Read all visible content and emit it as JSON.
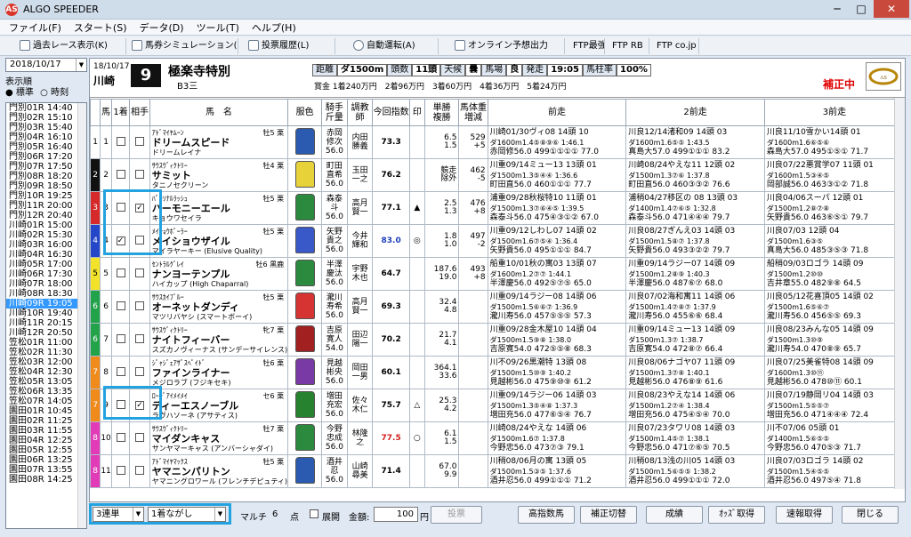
{
  "app": {
    "title": "ALGO SPEEDER",
    "icon_text": "AS"
  },
  "menu": [
    "ファイル(F)",
    "スタート(S)",
    "データ(D)",
    "ツール(T)",
    "ヘルプ(H)"
  ],
  "toolbar": [
    "過去レース表示(K)",
    "馬券シミュレーション(B)",
    "投票履歴(L)",
    "自動運転(A)",
    "オンライン予想出力",
    "FTP最強",
    "FTP RB",
    "FTP co.jp"
  ],
  "left": {
    "date": "2018/10/17",
    "display_order_label": "表示順",
    "radio_standard": "● 標準",
    "radio_time": "○ 時刻",
    "races": [
      "門別01R 14:40",
      "門別02R 15:10",
      "門別03R 15:40",
      "門別04R 16:10",
      "門別05R 16:40",
      "門別06R 17:20",
      "門別07R 17:50",
      "門別08R 18:20",
      "門別09R 18:50",
      "門別10R 19:25",
      "門別11R 20:00",
      "門別12R 20:40",
      "川崎01R 15:00",
      "川崎02R 15:30",
      "川崎03R 16:00",
      "川崎04R 16:30",
      "川崎05R 17:00",
      "川崎06R 17:30",
      "川崎07R 18:00",
      "川崎08R 18:30",
      "川崎09R 19:05",
      "川崎10R 19:40",
      "川崎11R 20:15",
      "川崎12R 20:50",
      "笠松01R 11:00",
      "笠松02R 11:30",
      "笠松03R 12:00",
      "笠松04R 12:30",
      "笠松05R 13:05",
      "笠松06R 13:35",
      "笠松07R 14:05",
      "園田01R 10:45",
      "園田02R 11:25",
      "園田03R 11:55",
      "園田04R 12:25",
      "園田05R 12:55",
      "園田06R 13:25",
      "園田07R 13:55",
      "園田08R 14:25"
    ],
    "selected_index": 20
  },
  "race": {
    "date": "18/10/17",
    "track": "川崎",
    "number": "9",
    "name": "極楽寺特別",
    "class": "B3三",
    "conditions": [
      [
        "距離",
        "ダ1500m"
      ],
      [
        "頭数",
        "11頭"
      ],
      [
        "天候",
        "曇"
      ],
      [
        "馬場",
        "良"
      ],
      [
        "発走",
        "19:05"
      ],
      [
        "馬柱率",
        "100%"
      ]
    ],
    "prize": "賞金 1着240万円　2着96万円　3着60万円　4着36万円　5着24万円",
    "status": "補正中"
  },
  "columns": [
    "馬",
    "1着",
    "相手",
    "馬　名",
    "服色",
    "騎手\n斤量",
    "調教\n師",
    "今回指数",
    "印",
    "単勝\n複勝",
    "馬体重\n増減",
    "前走",
    "2前走",
    "3前走"
  ],
  "horses": [
    {
      "waku": "1",
      "wcolor": "#ffffff",
      "wtext": "#000",
      "num": "1",
      "c1": "",
      "c2": "",
      "sire": "ｱﾄﾞﾏｲﾔﾑｰﾝ",
      "name": "ドリームスピード",
      "dam": "ドリームレイナ",
      "sex": "牡5 栗",
      "jockey": "赤岡\n修次\n56.0",
      "trainer": "内田\n勝義",
      "index": "73.3",
      "idxcolor": "#000",
      "mark": "",
      "odds": "6.5\n1.5",
      "weight": "529\n+5",
      "p1": [
        "川崎01/30ヴィ08 14頭 10",
        "ダ1600m1.4⑤⑧⑨⑥ 1:46.1",
        "赤岡修56.0 499①①①① 77.0"
      ],
      "p2": [
        "川良12/14渚和09 14頭 03",
        "ダ1600m1.6⑤⑤ 1:43.5",
        "真島大57.0 499①①① 83.2"
      ],
      "p3": [
        "川良11/10雪かい14頭 01",
        "ダ1600m1.6⑥⑤⑥",
        "森島大57.0 495①⑤① 71.7"
      ],
      "silk": "#2a5bb0"
    },
    {
      "waku": "2",
      "wcolor": "#111111",
      "wtext": "#fff",
      "num": "2",
      "c1": "",
      "c2": "",
      "sire": "ｻｳｽｳﾞｨｸﾄﾘｰ",
      "name": "サミット",
      "dam": "タニノセクリーン",
      "sex": "牡4 栗",
      "jockey": "町田\n直希\n56.0",
      "trainer": "玉田\n一之",
      "index": "76.2",
      "idxcolor": "#000",
      "mark": "",
      "odds": "競走\n除外",
      "weight": "462\n-5",
      "p1": [
        "川重09/14ミュー13 13頭 01",
        "ダ1500m1.3⑤④④ 1:36.6",
        "町田直56.0 460①①① 77.7"
      ],
      "p2": [
        "川崎08/24やえな11 12頭 02",
        "ダ1500m1.3⑦⑥ 1:37.8",
        "町田直56.0 460③③② 76.6"
      ],
      "p3": [
        "川良07/22悪賞学07 11頭 01",
        "ダ1600m1.5③④⑤",
        "岡部誠56.0 463③①② 71.8"
      ],
      "silk": "#e8d23a"
    },
    {
      "waku": "3",
      "wcolor": "#d62a2a",
      "wtext": "#fff",
      "num": "3",
      "c1": "",
      "c2": "✓",
      "sire": "ﾊﾟｰｿﾅﾙﾗｯｼｭ",
      "name": "ハーモニーエール",
      "dam": "キョウワセイラ",
      "sex": "牡5 栗",
      "jockey": "森泰\n斗\n56.0",
      "trainer": "高月\n賢一",
      "index": "77.1",
      "idxcolor": "#000",
      "mark": "▲",
      "odds": "2.5\n1.3",
      "weight": "476\n+8",
      "p1": [
        "浦重09/28秋桜特10 11頭 01",
        "ダ1500m1.3⑦⑥④⑤ 1:39.5",
        "森泰斗56.0 475④③①② 67.0"
      ],
      "p2": [
        "浦稍04/27移区の 08 13頭 03",
        "ダ1400m1.4⑦⑥⑤ 1:32.8",
        "森泰斗56.0 471④④④ 79.7"
      ],
      "p3": [
        "川良04/06スーパ 12頭 01",
        "ダ1500m1.2⑧⑦⑧",
        "矢野貴56.0 463⑥⑤① 79.7"
      ],
      "silk": "#2c8a3e"
    },
    {
      "waku": "4",
      "wcolor": "#2446c9",
      "wtext": "#fff",
      "num": "4",
      "c1": "✓",
      "c2": "",
      "sire": "ﾒｲｼｮｳﾎﾞｰﾗｰ",
      "name": "メイショウザイル",
      "dam": "マイラヤーキー (Elusive Quality)",
      "sex": "牡5 栗",
      "jockey": "矢野\n貴之\n56.0",
      "trainer": "今井\n輝和",
      "index": "83.0",
      "idxcolor": "#1c3fb8",
      "mark": "◎",
      "odds": "1.8\n1.0",
      "weight": "497\n-2",
      "p1": [
        "川重09/12しわし07 14頭 02",
        "ダ1500m1.6⑦⑤④ 1:36.4",
        "矢野貴56.0 495①①① 84.7"
      ],
      "p2": [
        "川良08/27ぎんえ03 14頭 03",
        "ダ1500m1.5⑧⑦ 1:37.8",
        "矢野貴56.0 493③②② 79.7"
      ],
      "p3": [
        "川良07/03 12頭 04",
        "ダ1500m1.6③⑤",
        "真島大56.0 485③⑤③ 71.8"
      ],
      "silk": "#3a59c8"
    },
    {
      "waku": "5",
      "wcolor": "#f2e32a",
      "wtext": "#000",
      "num": "5",
      "c1": "",
      "c2": "",
      "sire": "ｾﾝﾄﾗﾙｸﾞﾚｲ",
      "name": "ナンヨーテンプル",
      "dam": "ハイカップ (High Chaparral)",
      "sex": "牡6 黒鹿",
      "jockey": "半澤\n慶汰\n56.0",
      "trainer": "宇野\n木也",
      "index": "64.7",
      "idxcolor": "#000",
      "mark": "",
      "odds": "187.6\n19.0",
      "weight": "493\n+8",
      "p1": [
        "船重10/01秋の寓03 13頭 07",
        "ダ1600m1.2⑦⑦ 1:44.1",
        "半澤慶56.0 492⑤⑦⑤ 65.0"
      ],
      "p2": [
        "川重09/14ラジー07 14頭 09",
        "ダ1500m1.2⑧⑨ 1:40.3",
        "半澤慶56.0 487⑥⑦ 68.0"
      ],
      "p3": [
        "船稍09/03ロゴラ 14頭 09",
        "ダ1500m1.2⑩⑩",
        "吉井章55.0 482⑨⑧ 64.5"
      ],
      "silk": "#2c8a3e"
    },
    {
      "waku": "6",
      "wcolor": "#22a34a",
      "wtext": "#fff",
      "num": "6",
      "c1": "",
      "c2": "",
      "sire": "ｻｳｽｶｲﾌﾞﾙｰ",
      "name": "オーネットダンディ",
      "dam": "マツリバヤシ (スマートボーイ)",
      "sex": "牡5 栗",
      "jockey": "瀧川\n寿希\n56.0",
      "trainer": "高月\n賢一",
      "index": "69.3",
      "idxcolor": "#000",
      "mark": "",
      "odds": "32.4\n4.8",
      "weight": "",
      "p1": [
        "川重09/14ラジー08 14頭 06",
        "ダ1500m1.5⑥⑥⑦ 1:36.9",
        "瀧川寿56.0 457⑤⑤⑤ 57.3"
      ],
      "p2": [
        "川良07/02海和寓11 14頭 06",
        "ダ1500m1.4⑦⑧⑦ 1:37.9",
        "瀧川寿56.0 455⑥⑥ 68.4"
      ],
      "p3": [
        "川良05/12花喜頂05 14頭 02",
        "ダ1500m1.6⑤⑥⑦",
        "瀧川寿56.0 456⑤⑤ 69.3"
      ],
      "silk": "#d63333"
    },
    {
      "waku": "6",
      "wcolor": "#22a34a",
      "wtext": "#fff",
      "num": "7",
      "c1": "",
      "c2": "",
      "sire": "ｻｳｽｳﾞｨｸﾄﾘｰ",
      "name": "ナイトフィーバー",
      "dam": "スズカノヴィーナス (サンデーサイレンス)",
      "sex": "牝7 栗",
      "jockey": "吉原\n寛人\n54.0",
      "trainer": "田辺\n陽一",
      "index": "70.2",
      "idxcolor": "#000",
      "mark": "",
      "odds": "21.7\n4.1",
      "weight": "",
      "p1": [
        "川重09/28金木屋10 14頭 04",
        "ダ1500m1.5⑨⑧ 1:38.0",
        "吉原寛54.0 472⑤⑤⑧ 68.3"
      ],
      "p2": [
        "川重09/14ミュー13 14頭 09",
        "ダ1500m1.3⑦ 1:38.7",
        "吉原寛54.0 472⑧⑦ 66.4"
      ],
      "p3": [
        "川良08/23みんな05 14頭 09",
        "ダ1500m1.3⑩⑨",
        "瀧川寿54.0 470⑧⑨ 65.7"
      ],
      "silk": "#a22020"
    },
    {
      "waku": "7",
      "wcolor": "#f08a1a",
      "wtext": "#fff",
      "num": "8",
      "c1": "",
      "c2": "",
      "sire": "ｼﾞｬｼﾞｪｱｻﾞｽﾍﾟｲﾄﾞ",
      "name": "ファインライナー",
      "dam": "メジロラブ (フジキセキ)",
      "sex": "牡6 栗",
      "jockey": "見越\n彬央\n56.0",
      "trainer": "岡田\n一男",
      "index": "60.1",
      "idxcolor": "#000",
      "mark": "",
      "odds": "364.1\n33.6",
      "weight": "",
      "p1": [
        "川不09/26黒潮特 13頭 08",
        "ダ1500m1.5⑩⑨ 1:40.2",
        "見越彬56.0 475⑨⑩⑨ 61.2"
      ],
      "p2": [
        "川良08/06ナゴヤ07 11頭 09",
        "ダ1500m1.3⑦⑧ 1:40.1",
        "見越彬56.0 476⑧⑨ 61.6"
      ],
      "p3": [
        "川良07/25美雀特08 14頭 09",
        "ダ1600m1.3⑩⑪",
        "見越彬56.0 478⑩⑪ 60.1"
      ],
      "silk": "#7a3aa6"
    },
    {
      "waku": "7",
      "wcolor": "#f08a1a",
      "wtext": "#fff",
      "num": "9",
      "c1": "",
      "c2": "✓",
      "sire": "ﾛｰｼﾞｱｲﾒｲﾒｲ",
      "name": "ディーエスノーブル",
      "dam": "ラヴハソーネ (アサティス)",
      "sex": "セ6 栗",
      "jockey": "増田\n充宏\n56.0",
      "trainer": "佐々\n木仁",
      "index": "75.7",
      "idxcolor": "#000",
      "mark": "△",
      "odds": "25.3\n4.2",
      "weight": "",
      "p1": [
        "川重09/14ラジー06 14頭 03",
        "ダ1500m1.3⑤④⑧ 1:37.3",
        "増田充56.0 477⑥⑤④ 76.7"
      ],
      "p2": [
        "川良08/23やえな14 14頭 06",
        "ダ1500m1.2⑦④ 1:38.4",
        "増田充56.0 475④⑤④ 70.0"
      ],
      "p3": [
        "川良07/19静岡リ04 14頭 03",
        "ダ1500m1.5⑤⑤⑦",
        "増田充56.0 471④④④ 72.4"
      ],
      "silk": "#27822f"
    },
    {
      "waku": "8",
      "wcolor": "#e23bb8",
      "wtext": "#fff",
      "num": "10",
      "c1": "",
      "c2": "",
      "sire": "ｻｳｽｳﾞｨｸﾄﾘｰ",
      "name": "マイダンキャス",
      "dam": "サンヤマーキャス (アンバーシャダイ)",
      "sex": "牡7 栗",
      "jockey": "今野\n忠成\n56.0",
      "trainer": "林隆\n之",
      "index": "77.5",
      "idxcolor": "#d22020",
      "mark": "○",
      "odds": "6.1\n1.5",
      "weight": "",
      "p1": [
        "川崎08/24やえな 14頭 06",
        "ダ1500m1.6⑦ 1:37.8",
        "今野忠56.0 473⑦③ 79.1"
      ],
      "p2": [
        "川良07/23タワリ08 14頭 03",
        "ダ1500m1.4⑤⑦ 1:38.1",
        "今野忠56.0 471⑦⑥⑤ 70.5"
      ],
      "p3": [
        "川不07/06 05頭 01",
        "ダ1400m1.5⑥⑤⑤",
        "今野忠56.0 470⑤③ 71.7"
      ],
      "silk": "#2c8a3e"
    },
    {
      "waku": "8",
      "wcolor": "#e23bb8",
      "wtext": "#fff",
      "num": "11",
      "c1": "",
      "c2": "",
      "sire": "ｱﾄﾞﾏｲﾔﾏｯｸｽ",
      "name": "ヤマニンパリトン",
      "dam": "ヤマニングロワール (フレンチデピュティ)",
      "sex": "牡5 栗",
      "jockey": "酒井\n忍\n56.0",
      "trainer": "山崎\n尋美",
      "index": "71.4",
      "idxcolor": "#000",
      "mark": "",
      "odds": "67.0\n9.9",
      "weight": "",
      "p1": [
        "川稍08/06月の寓 13頭 05",
        "ダ1500m1.5③⑤ 1:37.6",
        "酒井忍56.0 499①①① 71.2"
      ],
      "p2": [
        "川稍08/13浅の川05 14頭 03",
        "ダ1500m1.5⑥⑤⑤ 1:38.2",
        "酒井忍56.0 499①①① 72.0"
      ],
      "p3": [
        "川良07/03ロゴラ 14頭 02",
        "ダ1500m1.5④⑤⑤",
        "酒井忍56.0 497⑤④ 71.8"
      ],
      "silk": "#2a5bb0"
    }
  ],
  "bottom": {
    "bet_type": "3連単",
    "bet_mode": "1着ながし",
    "multi_label": "マルチ",
    "points": "6",
    "points_unit": "点",
    "expand_label": "展開",
    "amount_label": "金額:",
    "amount": "100",
    "amount_unit": "円",
    "buttons": [
      "投票",
      "高指数馬",
      "補正切替",
      "成績",
      "ｵｯｽﾞ取得",
      "速報取得",
      "閉じる"
    ]
  }
}
